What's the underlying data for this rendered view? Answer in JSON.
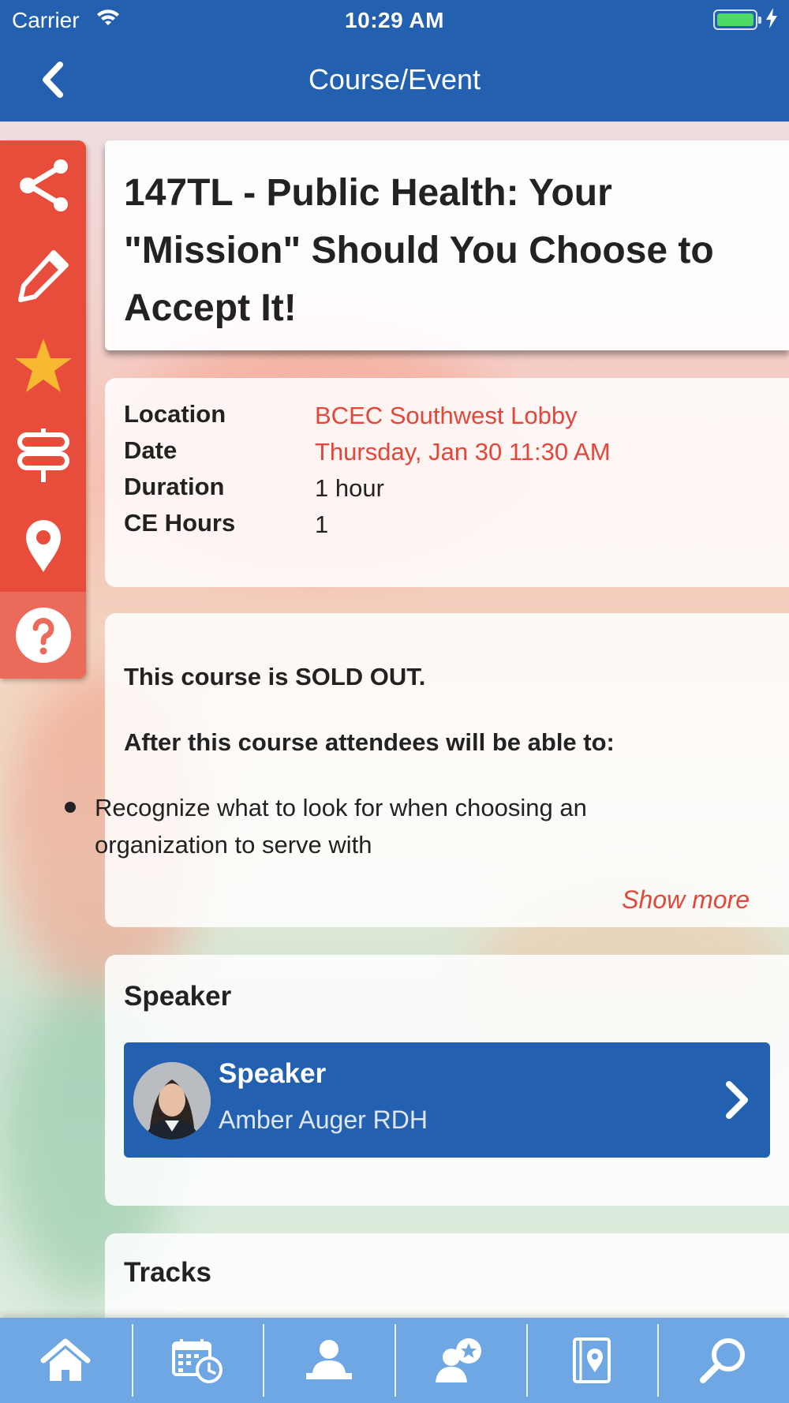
{
  "status_bar": {
    "carrier": "Carrier",
    "time": "10:29 AM"
  },
  "nav": {
    "title": "Course/Event"
  },
  "side_rail": {
    "items": [
      "share-icon",
      "pencil-icon",
      "star-icon",
      "signpost-icon",
      "map-pin-icon",
      "help-icon"
    ]
  },
  "event": {
    "title": "147TL - Public Health: Your \"Mission\" Should You Choose to Accept It!",
    "details": [
      {
        "label": "Location",
        "value": "BCEC Southwest Lobby"
      },
      {
        "label": "Date",
        "value": "Thursday, Jan 30 11:30 AM"
      },
      {
        "label": "Duration",
        "value": "1 hour"
      },
      {
        "label": "CE Hours",
        "value": "1"
      }
    ],
    "description": {
      "sold_out": "This course is SOLD OUT.",
      "objectives_heading": "After this course attendees will be able to:",
      "bullets": [
        "Recognize what to look for when choosing an organization to serve with"
      ],
      "show_more": "Show more"
    }
  },
  "speaker_section": {
    "heading": "Speaker",
    "speaker": {
      "role": "Speaker",
      "name": "Amber Auger RDH"
    }
  },
  "tracks_section": {
    "heading": "Tracks"
  },
  "tab_bar": {
    "tabs": [
      "home-icon",
      "calendar-clock-icon",
      "attendee-icon",
      "speaker-star-icon",
      "map-book-icon",
      "search-icon"
    ]
  },
  "colors": {
    "primary": "#2360b0",
    "accent": "#e84c3b",
    "tabbar": "#6ea7e3"
  }
}
